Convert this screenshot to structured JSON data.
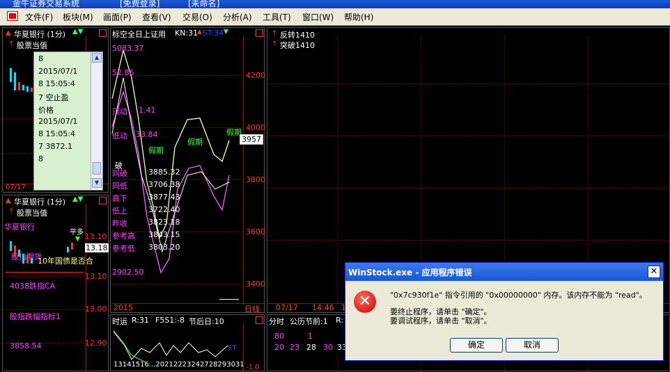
{
  "window": {
    "title_fragments": [
      "金牛证券交易系统",
      "[免费登录]",
      "[未命名]"
    ]
  },
  "menu": {
    "items": [
      "文件(F)",
      "板块(M)",
      "画面(P)",
      "查看(V)",
      "交易(O)",
      "分析(A)",
      "工具(T)",
      "窗口(W)",
      "帮助(H)"
    ]
  },
  "left_top": {
    "title": "华夏银行 (1分)",
    "subtitle": "股票当值",
    "date": "07/17"
  },
  "tooltip": {
    "lines": [
      "8",
      "2015/07/1",
      "8 15:05:4",
      "7  空止盈",
      "价格",
      "2015/07/1",
      "8 15:05:4",
      "7  3872.1",
      "8"
    ]
  },
  "left_bottom": {
    "title": "华夏银行 (1分)",
    "subtitle": "股票当值",
    "labels": [
      "华夏银行",
      "平多",
      "股指期货",
      "10年国债是否合",
      "4038跌指CA",
      "股指跌幅指标1",
      "3858.54"
    ],
    "prices": [
      "13.10",
      "13.18",
      "13.00",
      "12.90"
    ]
  },
  "center": {
    "title": "标空全日上证用",
    "kn": "KN:31",
    "st": "ST:34",
    "labels": [
      "5083.37",
      "52.86",
      "顶动",
      "1.41",
      "低动",
      "33.84",
      "假期",
      "假期",
      "假期",
      "破",
      "同破",
      "3885.32",
      "同低",
      "3706.38",
      "高下",
      "3877.43",
      "低上",
      "3722.40",
      "昨收",
      "3823.18",
      "参考高",
      "3843.15",
      "参考低",
      "3803.20",
      "2902.50",
      "2015",
      "日线"
    ],
    "yaxis": [
      "4200",
      "4000",
      "3800",
      "3600",
      "3400"
    ],
    "current": "3957"
  },
  "center_bottom": {
    "title": "时运",
    "r": "R:31",
    "f": "F5S1:-8",
    "j": "节后日:10",
    "xlabels": "13141516...20212223242728293031",
    "right": [
      "ST",
      "-1.0"
    ]
  },
  "right_top": {
    "labels": [
      "反转1410",
      "突破1410"
    ],
    "xaxis": [
      "07/17",
      "14:46",
      "16"
    ]
  },
  "right_bottom": {
    "title": "分时",
    "sub": "公历节前:1",
    "r": "R:",
    "row1": [
      "80",
      "1"
    ],
    "row2": [
      "20",
      "23",
      "28",
      "30",
      "33"
    ]
  },
  "dialog": {
    "title": "WinStock.exe - 应用程序错误",
    "line1": "\"0x7c930f1e\" 指令引用的 \"0x00000000\" 内存。该内存不能为 \"read\"。",
    "line2": "要终止程序，请单击 \"确定\"。",
    "line3": "要调试程序，请单击 \"取消\"。",
    "ok": "确定",
    "cancel": "取消"
  },
  "colors": {
    "accent_red": "#ff2020",
    "magenta": "#ff40ff",
    "green": "#40ff40",
    "dialog_title": "#1a56d6"
  }
}
